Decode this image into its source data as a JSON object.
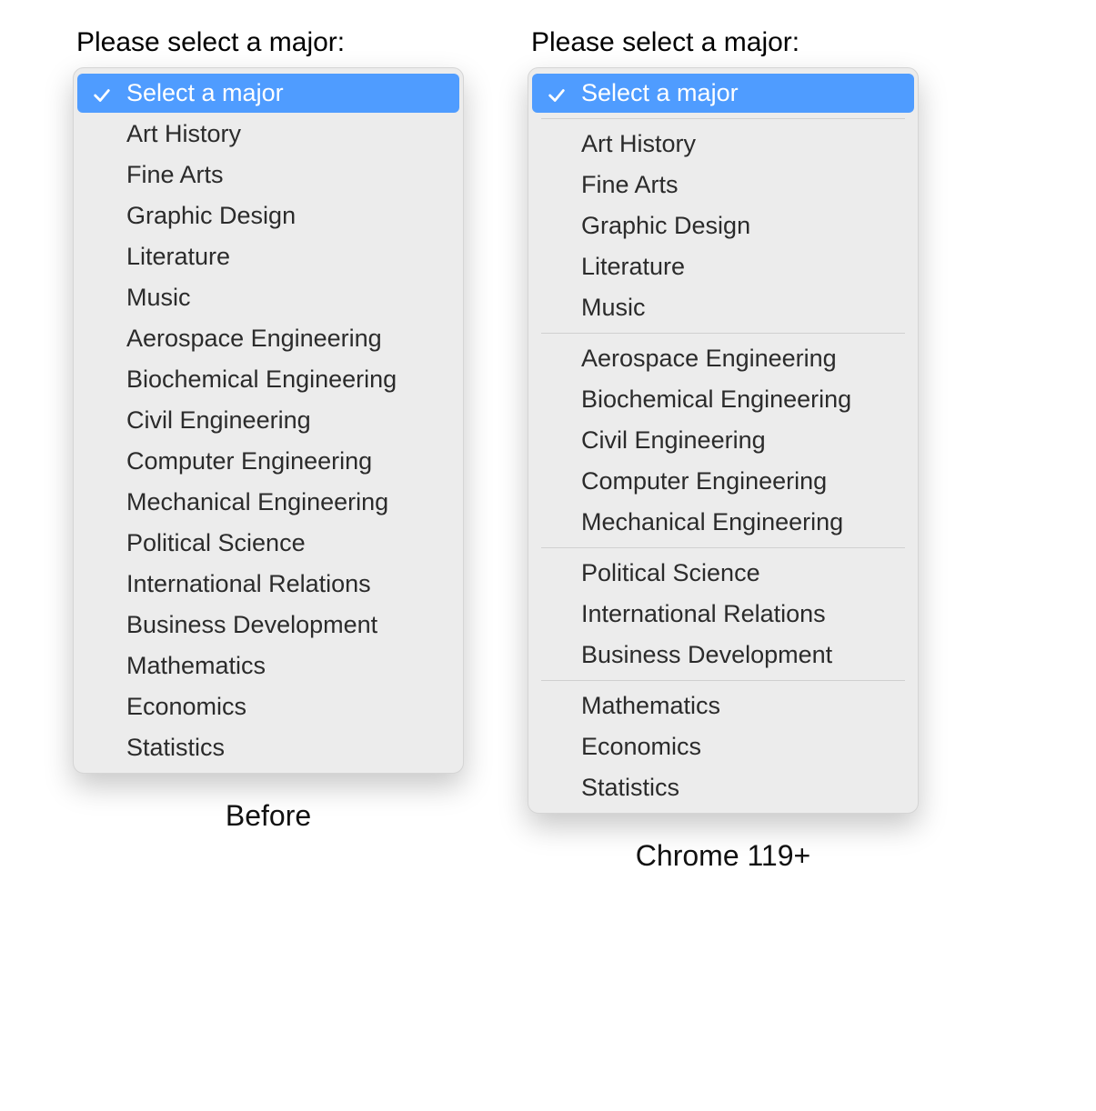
{
  "prompt": "Please select a major:",
  "selected_label": "Select a major",
  "captions": {
    "left": "Before",
    "right": "Chrome 119+"
  },
  "left": {
    "items": [
      "Art History",
      "Fine Arts",
      "Graphic Design",
      "Literature",
      "Music",
      "Aerospace Engineering",
      "Biochemical Engineering",
      "Civil Engineering",
      "Computer Engineering",
      "Mechanical Engineering",
      "Political Science",
      "International Relations",
      "Business Development",
      "Mathematics",
      "Economics",
      "Statistics"
    ]
  },
  "right": {
    "groups": [
      [
        "Art History",
        "Fine Arts",
        "Graphic Design",
        "Literature",
        "Music"
      ],
      [
        "Aerospace Engineering",
        "Biochemical Engineering",
        "Civil Engineering",
        "Computer Engineering",
        "Mechanical Engineering"
      ],
      [
        "Political Science",
        "International Relations",
        "Business Development"
      ],
      [
        "Mathematics",
        "Economics",
        "Statistics"
      ]
    ]
  }
}
